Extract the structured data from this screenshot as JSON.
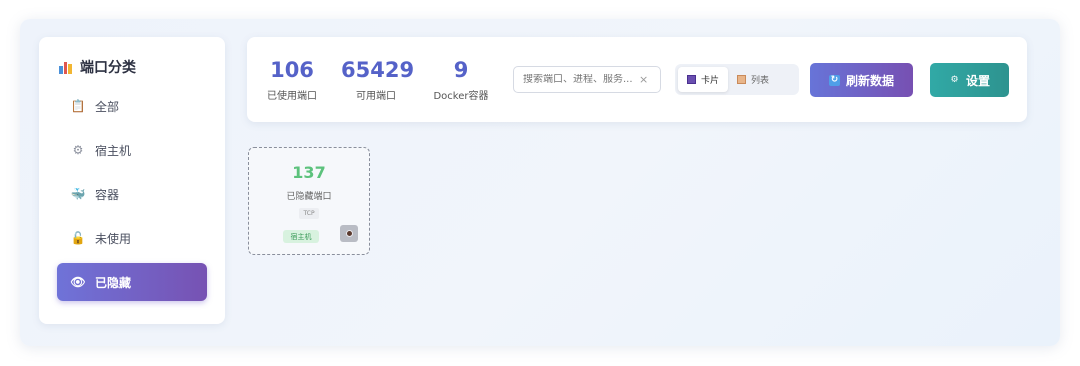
{
  "sidebar": {
    "title": "端口分类",
    "items": [
      {
        "label": "全部",
        "icon": "clipboard-icon"
      },
      {
        "label": "宿主机",
        "icon": "gear-icon"
      },
      {
        "label": "容器",
        "icon": "whale-icon"
      },
      {
        "label": "未使用",
        "icon": "unlock-icon"
      },
      {
        "label": "已隐藏",
        "icon": "eye-icon",
        "active": true
      }
    ]
  },
  "stats": [
    {
      "value": "106",
      "label": "已使用端口"
    },
    {
      "value": "65429",
      "label": "可用端口"
    },
    {
      "value": "9",
      "label": "Docker容器"
    }
  ],
  "search": {
    "placeholder": "搜索端口、进程、服务..."
  },
  "view_toggle": {
    "card_label": "卡片",
    "list_label": "列表",
    "selected": "card"
  },
  "buttons": {
    "refresh_label": "刷新数据",
    "settings_label": "设置"
  },
  "port_card": {
    "number": "137",
    "label": "已隐藏端口",
    "protocol": "TCP",
    "tag": "宿主机"
  },
  "colors": {
    "accent": "#5562c8",
    "active_nav": "#7752b3",
    "settings": "#31a9a6",
    "port_number": "#5cc27c"
  }
}
